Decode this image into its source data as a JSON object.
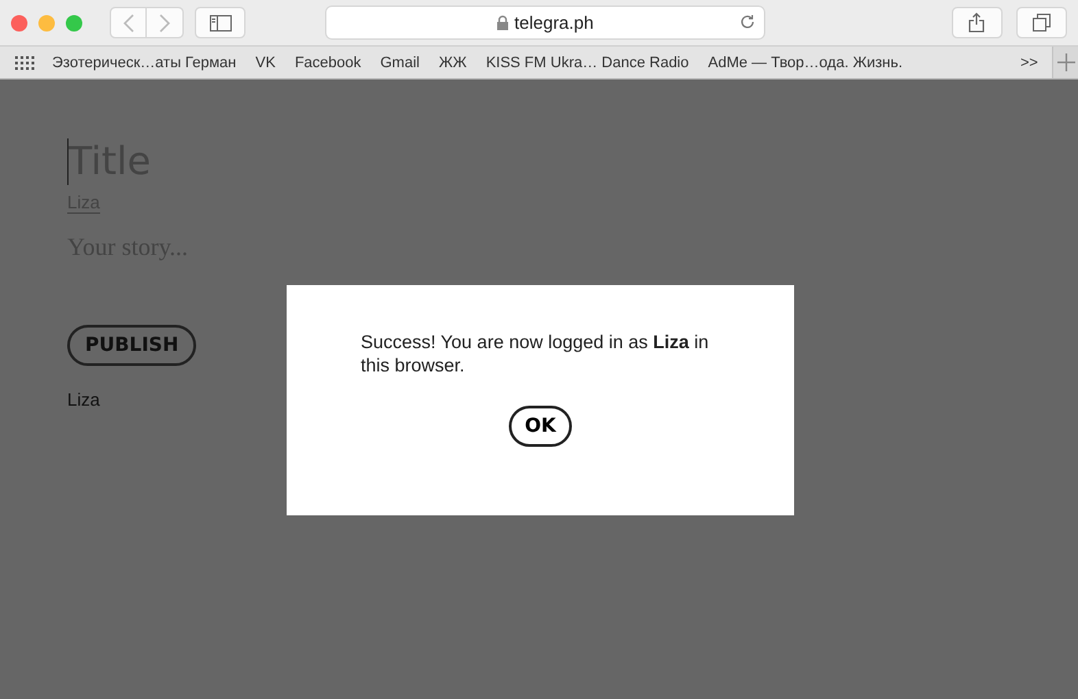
{
  "toolbar": {
    "url": "telegra.ph"
  },
  "bookmarks": {
    "items": [
      "Эзотерическ…аты Герман",
      "VK",
      "Facebook",
      "Gmail",
      "ЖЖ",
      "KISS FM Ukra… Dance Radio",
      "AdMe — Твор…ода. Жизнь."
    ],
    "overflow": ">>"
  },
  "editor": {
    "title_placeholder": "Title",
    "author": "Liza",
    "story_placeholder": "Your story...",
    "publish_button": "PUBLISH",
    "author_footer": "Liza"
  },
  "dialog": {
    "message": "Success! You are now logged in as **Liza** in this browser.",
    "ok_button": "OK"
  }
}
